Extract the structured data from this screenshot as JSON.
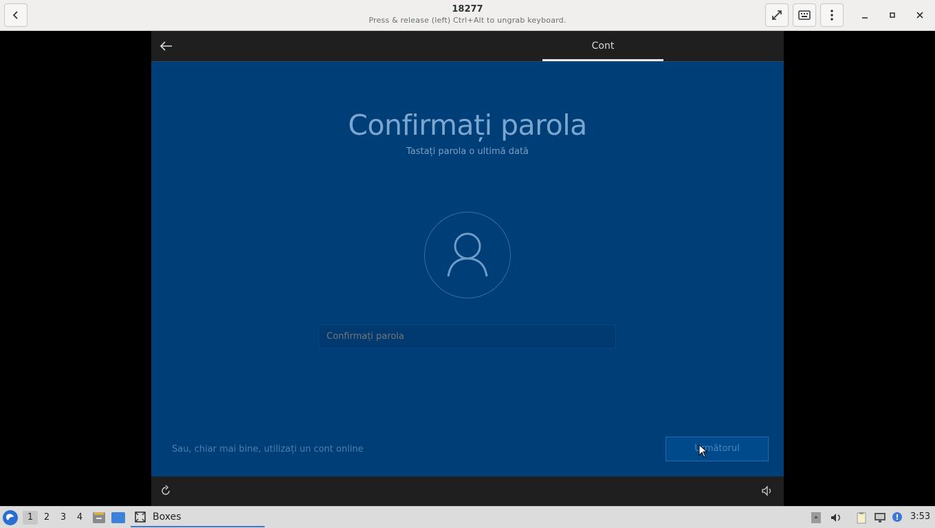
{
  "header": {
    "title": "18277",
    "subtitle": "Press & release (left) Ctrl+Alt to ungrab keyboard.",
    "back_icon": "chevron-left-icon",
    "fullscreen_icon": "fullscreen-icon",
    "keyboard_icon": "keyboard-icon",
    "menu_icon": "vertical-dots-icon",
    "minimize_icon": "minimize-icon",
    "maximize_icon": "maximize-icon",
    "close_icon": "close-icon"
  },
  "vm": {
    "top_bar": {
      "tab_label": "Cont"
    },
    "page": {
      "title": "Confirmați parola",
      "subtitle": "Tastați parola o ultimă dată",
      "password_placeholder": "Confirmați parola",
      "password_value": ""
    },
    "footer": {
      "online_link": "Sau, chiar mai bine, utilizați un cont online",
      "next_button": "Următorul"
    },
    "colors": {
      "background": "#003e78",
      "bar": "#1f1f1f",
      "accent": "#7aa6cf"
    }
  },
  "taskbar": {
    "workspaces": [
      "1",
      "2",
      "3",
      "4"
    ],
    "active_workspace": "1",
    "task_label": "Boxes",
    "clock": "3:53"
  }
}
